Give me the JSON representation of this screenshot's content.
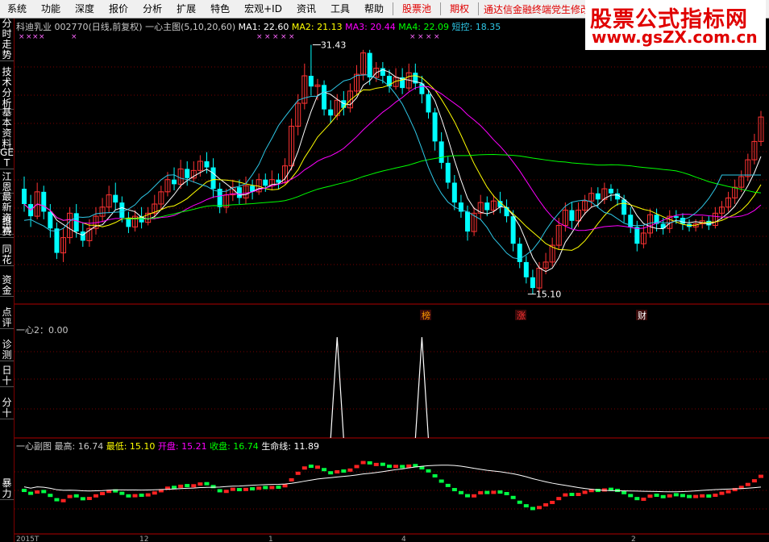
{
  "menu": [
    "系统",
    "功能",
    "深度",
    "报价",
    "分析",
    "扩展",
    "特色",
    "宏观+ID",
    "资讯",
    "工具",
    "帮助"
  ],
  "menu_red": [
    "股票池",
    "期权"
  ],
  "ticker_text": "通达信金融终端党生修改",
  "watermark": {
    "title": "股票公式指标网",
    "url": "www.gsZX.com.cn"
  },
  "sidebar_tabs": [
    "分时走势",
    "技术分析",
    "基本资料",
    "GET",
    "江恩",
    "最新资讯",
    "维赛",
    "同花",
    "资金",
    "点评",
    "诊测",
    "日十",
    "分十",
    "暴力"
  ],
  "main_header": {
    "stock": "科迪乳业 002770(日线,前复权)",
    "indicator": "一心主图(5,10,20,60)",
    "ma1": "MA1: 22.60",
    "ma2": "MA2: 21.13",
    "ma3": "MA3: 20.44",
    "ma4": "MA4: 22.09",
    "short": "短控: 18.35"
  },
  "annotations": {
    "high": "31.43",
    "low": "15.10",
    "tag_bang": "榜",
    "tag_zhang": "涨",
    "tag_cai": "财"
  },
  "sub1_header": "一心2：0.00",
  "sub2_header": {
    "name": "一心副图",
    "high": "最高: 16.74",
    "low": "最低: 15.10",
    "open": "开盘: 15.21",
    "close": "收盘: 16.74",
    "life": "生命线: 11.89"
  },
  "bottom_axis": [
    "2015T",
    "12",
    "1",
    "4",
    "2"
  ],
  "colors": {
    "up": "#ff3333",
    "down": "#00ffff",
    "ma1": "#ffffff",
    "ma2": "#ffff00",
    "ma3": "#ff00ff",
    "ma4": "#00ff00",
    "short": "#2ec7e6",
    "grid": "#7a0000"
  },
  "chart_data": {
    "type": "candlestick",
    "title": "科迪乳业 002770(日线,前复权)",
    "y_high": 31.43,
    "y_low": 15.1,
    "candles": [
      [
        22,
        21,
        22.8,
        20.5
      ],
      [
        21,
        20.2,
        21.6,
        19.5
      ],
      [
        20.2,
        21.8,
        22.4,
        20
      ],
      [
        21.8,
        20.5,
        22.2,
        20
      ],
      [
        20.5,
        19.4,
        21,
        18.8
      ],
      [
        19.4,
        17.8,
        19.8,
        17.4
      ],
      [
        17.8,
        18.8,
        19.4,
        17.2
      ],
      [
        18.8,
        20.4,
        20.8,
        18.4
      ],
      [
        20.4,
        19.2,
        21,
        18.8
      ],
      [
        19.2,
        18.6,
        19.8,
        18.2
      ],
      [
        18.6,
        19.4,
        20,
        18.2
      ],
      [
        19.4,
        20.2,
        20.8,
        19
      ],
      [
        20.2,
        20.8,
        21.4,
        19.8
      ],
      [
        20.8,
        21.6,
        22.2,
        20.4
      ],
      [
        21.6,
        21.1,
        22.4,
        20.6
      ],
      [
        21.1,
        20.1,
        21.5,
        19.8
      ],
      [
        20.1,
        19.5,
        20.5,
        19.1
      ],
      [
        19.5,
        20.2,
        20.6,
        19.2
      ],
      [
        20.2,
        19.8,
        20.8,
        19.4
      ],
      [
        19.8,
        20.4,
        20.8,
        19.6
      ],
      [
        20.4,
        21,
        21.6,
        20
      ],
      [
        21,
        21.8,
        22.2,
        20.6
      ],
      [
        21.8,
        22.6,
        23.1,
        21.5
      ],
      [
        22.6,
        22.3,
        23.4,
        21.9
      ],
      [
        22.3,
        23.3,
        23.9,
        22
      ],
      [
        23.3,
        22.7,
        23.8,
        22.2
      ],
      [
        22.7,
        23.2,
        23.8,
        22.4
      ],
      [
        23.2,
        23.8,
        24.2,
        22.8
      ],
      [
        23.8,
        23.4,
        24.4,
        23
      ],
      [
        23.4,
        22,
        24,
        21.4
      ],
      [
        22,
        20.8,
        22.4,
        20.4
      ],
      [
        20.8,
        21.6,
        22,
        20.4
      ],
      [
        21.6,
        22.1,
        22.6,
        21.2
      ],
      [
        22.1,
        21.4,
        22.6,
        21
      ],
      [
        21.4,
        22.2,
        22.8,
        21
      ],
      [
        22.2,
        21.8,
        22.6,
        21.3
      ],
      [
        21.8,
        22.6,
        23,
        21.6
      ],
      [
        22.6,
        22.2,
        23,
        21.8
      ],
      [
        22.2,
        22.6,
        23.2,
        21.9
      ],
      [
        22.6,
        22.4,
        23,
        22
      ],
      [
        22.4,
        23.5,
        24,
        22.3
      ],
      [
        23.5,
        26.1,
        26.6,
        23.2
      ],
      [
        26.1,
        27.6,
        28.2,
        25.5
      ],
      [
        27.6,
        29.4,
        30.2,
        27.2
      ],
      [
        29.4,
        28.7,
        31.43,
        28.1
      ],
      [
        28.7,
        28.8,
        29.2,
        27.8
      ],
      [
        28.8,
        27.2,
        29.1,
        26.8
      ],
      [
        27.2,
        26.8,
        27.8,
        26.3
      ],
      [
        26.8,
        27.8,
        28.2,
        26.5
      ],
      [
        27.8,
        27.3,
        28.4,
        26.8
      ],
      [
        27.3,
        28.4,
        28.9,
        27
      ],
      [
        28.4,
        29.5,
        30.1,
        28.1
      ],
      [
        29.5,
        30.9,
        31.1,
        29.1
      ],
      [
        30.9,
        29.3,
        31.1,
        28.8
      ],
      [
        29.3,
        29.9,
        30.3,
        29
      ],
      [
        29.9,
        29.4,
        30.3,
        28.9
      ],
      [
        29.4,
        28.7,
        29.8,
        28.3
      ],
      [
        28.7,
        29.3,
        29.9,
        28.5
      ],
      [
        29.3,
        28.6,
        29.9,
        28.2
      ],
      [
        28.6,
        29.6,
        30.2,
        28.4
      ],
      [
        29.6,
        28.9,
        30.2,
        28.5
      ],
      [
        28.9,
        28.2,
        29.4,
        27.6
      ],
      [
        28.2,
        27,
        28.5,
        26.6
      ],
      [
        27,
        25.1,
        27.3,
        24.5
      ],
      [
        25.1,
        23.7,
        25.7,
        23.3
      ],
      [
        23.7,
        22.4,
        24.1,
        22
      ],
      [
        22.4,
        21.1,
        22.9,
        20.6
      ],
      [
        21.1,
        20.5,
        21.6,
        20.1
      ],
      [
        20.5,
        19.2,
        20.9,
        18.6
      ],
      [
        19.2,
        20.4,
        20.8,
        18.9
      ],
      [
        20.4,
        21.1,
        21.6,
        20
      ],
      [
        21.1,
        20.6,
        21.5,
        20.2
      ],
      [
        20.6,
        21.2,
        21.6,
        20.3
      ],
      [
        21.2,
        20.8,
        21.8,
        20.4
      ],
      [
        20.8,
        20.2,
        21.3,
        19.8
      ],
      [
        20.2,
        18.4,
        20.6,
        17.9
      ],
      [
        18.4,
        17.2,
        18.8,
        16.8
      ],
      [
        17.2,
        16.2,
        17.6,
        15.8
      ],
      [
        16.2,
        15.5,
        16.7,
        15.1
      ],
      [
        15.5,
        16.8,
        17.2,
        15.2
      ],
      [
        16.8,
        17.2,
        17.8,
        16.4
      ],
      [
        17.2,
        18.3,
        18.8,
        16.9
      ],
      [
        18.3,
        19.6,
        20.1,
        18
      ],
      [
        19.6,
        20.6,
        21.1,
        19.2
      ],
      [
        20.6,
        19.9,
        21.1,
        19.4
      ],
      [
        19.9,
        20.6,
        21.1,
        19.5
      ],
      [
        20.6,
        21.2,
        21.6,
        20.3
      ],
      [
        21.2,
        21.7,
        22.1,
        20.8
      ],
      [
        21.7,
        21.3,
        22.1,
        20.8
      ],
      [
        21.3,
        22,
        22.4,
        21
      ],
      [
        22,
        21.7,
        22.3,
        21.2
      ],
      [
        21.7,
        21.3,
        22,
        20.9
      ],
      [
        21.3,
        20.3,
        21.6,
        19.8
      ],
      [
        20.3,
        19.5,
        20.8,
        19.1
      ],
      [
        19.5,
        18.4,
        19.9,
        17.9
      ],
      [
        18.4,
        19.1,
        19.6,
        18.1
      ],
      [
        19.1,
        20.3,
        20.7,
        18.8
      ],
      [
        20.3,
        19.7,
        20.7,
        19.2
      ],
      [
        19.7,
        19.4,
        20.1,
        19
      ],
      [
        19.4,
        20.2,
        20.6,
        19.1
      ],
      [
        20.2,
        20.1,
        20.6,
        19.7
      ],
      [
        20.1,
        19.7,
        20.4,
        19.3
      ],
      [
        19.7,
        19.5,
        20,
        19.2
      ],
      [
        19.5,
        19.7,
        20,
        19.2
      ],
      [
        19.7,
        19.9,
        20.2,
        19.4
      ],
      [
        19.9,
        19.6,
        20.2,
        19.3
      ],
      [
        19.6,
        20.4,
        20.8,
        19.4
      ],
      [
        20.4,
        20.8,
        21.2,
        20
      ],
      [
        20.8,
        21.4,
        21.8,
        20.5
      ],
      [
        21.4,
        22.1,
        22.6,
        21
      ],
      [
        22.1,
        22.8,
        23.2,
        21.8
      ],
      [
        22.8,
        23.9,
        24.3,
        22.5
      ],
      [
        23.9,
        25.1,
        25.6,
        23.6
      ],
      [
        25.1,
        26.7,
        27.1,
        24.8
      ]
    ],
    "sub1_spikes": [
      48,
      61
    ]
  }
}
